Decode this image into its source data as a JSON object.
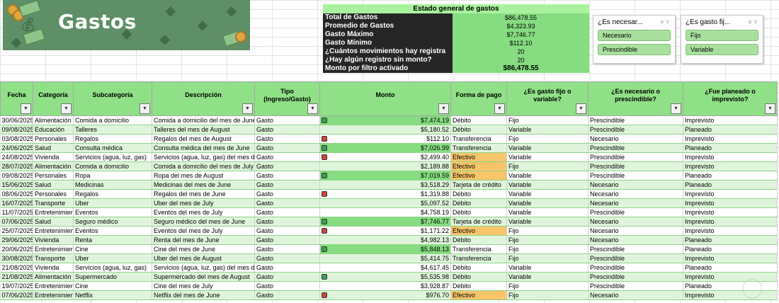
{
  "banner": {
    "title": "Gastos"
  },
  "summary": {
    "title": "Estado general de gastos",
    "rows": [
      {
        "label": "Total de Gastos",
        "value": "$86,478.55",
        "bold": false
      },
      {
        "label": "Promedio de Gastos",
        "value": "$4,323.93",
        "bold": false
      },
      {
        "label": "Gasto Máximo",
        "value": "$7,746.77",
        "bold": false
      },
      {
        "label": "Gasto Mínimo",
        "value": "$112.10",
        "bold": false
      },
      {
        "label": "¿Cuántos movimientos hay registra",
        "value": "20",
        "bold": false
      },
      {
        "label": "¿Hay algún registro sin monto?",
        "value": "20",
        "bold": false
      },
      {
        "label": "Monto por filtro activado",
        "value": "$86,478.55",
        "bold": true
      }
    ]
  },
  "slicers": [
    {
      "title": "¿Es necesar...",
      "items": [
        "Necesario",
        "Prescindible"
      ]
    },
    {
      "title": "¿Es gasto fij...",
      "items": [
        "Fijo",
        "Variable"
      ]
    }
  ],
  "table": {
    "headers": [
      "Fecha",
      "Categoría",
      "Subcategoría",
      "Descripción",
      "Tipo (Ingreso/Gasto)",
      "Monto",
      "Forma de pago",
      "¿Es gasto fijo o variable?",
      "¿Es necesario o prescindible?",
      "¿Fue planeado o imprevisto?"
    ],
    "rows": [
      [
        "30/06/2025",
        "Alimentación",
        "Comida a domicilio",
        "Comida a domicilio del mes de June",
        "Gasto",
        "$7,474.19",
        "Débito",
        "Fijo",
        "Prescindible",
        "Imprevisto"
      ],
      [
        "09/08/2025",
        "Educación",
        "Talleres",
        "Talleres del mes de August",
        "Gasto",
        "$5,180.52",
        "Débito",
        "Variable",
        "Prescindible",
        "Planeado"
      ],
      [
        "03/08/2025",
        "Personales",
        "Regalos",
        "Regalos del mes de August",
        "Gasto",
        "$112.10",
        "Transferencia",
        "Fijo",
        "Necesario",
        "Imprevisto"
      ],
      [
        "24/06/2025",
        "Salud",
        "Consulta médica",
        "Consulta médica del mes de June",
        "Gasto",
        "$7,026.99",
        "Transferencia",
        "Variable",
        "Prescindible",
        "Planeado"
      ],
      [
        "24/08/2025",
        "Vivienda",
        "Servicios (agua, luz, gas)",
        "Servicios (agua, luz, gas) del mes de August",
        "Gasto",
        "$2,499.40",
        "Efectivo",
        "Variable",
        "Prescindible",
        "Imprevisto"
      ],
      [
        "28/07/2025",
        "Alimentación",
        "Comida a domicilio",
        "Comida a domicilio del mes de July",
        "Gasto",
        "$2,189.88",
        "Efectivo",
        "Fijo",
        "Prescindible",
        "Imprevisto"
      ],
      [
        "09/08/2025",
        "Personales",
        "Ropa",
        "Ropa del mes de August",
        "Gasto",
        "$7,019.59",
        "Efectivo",
        "Variable",
        "Prescindible",
        "Planeado"
      ],
      [
        "15/06/2025",
        "Salud",
        "Medicinas",
        "Medicinas del mes de June",
        "Gasto",
        "$3,518.29",
        "Tarjeta de crédito",
        "Variable",
        "Necesario",
        "Planeado"
      ],
      [
        "08/06/2025",
        "Personales",
        "Regalos",
        "Regalos del mes de June",
        "Gasto",
        "$1,319.88",
        "Débito",
        "Variable",
        "Necesario",
        "Imprevisto"
      ],
      [
        "16/07/2025",
        "Transporte",
        "Uber",
        "Uber del mes de July",
        "Gasto",
        "$5,097.52",
        "Débito",
        "Variable",
        "Necesario",
        "Imprevisto"
      ],
      [
        "11/07/2025",
        "Entretenimiento",
        "Eventos",
        "Eventos del mes de July",
        "Gasto",
        "$4,758.19",
        "Débito",
        "Variable",
        "Prescindible",
        "Imprevisto"
      ],
      [
        "07/06/2025",
        "Salud",
        "Seguro médico",
        "Seguro médico del mes de June",
        "Gasto",
        "$7,746.77",
        "Tarjeta de crédito",
        "Variable",
        "Necesario",
        "Imprevisto"
      ],
      [
        "25/07/2025",
        "Entretenimiento",
        "Eventos",
        "Eventos del mes de July",
        "Gasto",
        "$1,171.22",
        "Efectivo",
        "Fijo",
        "Necesario",
        "Imprevisto"
      ],
      [
        "29/06/2025",
        "Vivienda",
        "Renta",
        "Renta del mes de June",
        "Gasto",
        "$4,982.13",
        "Débito",
        "Fijo",
        "Necesario",
        "Planeado"
      ],
      [
        "20/06/2025",
        "Entretenimiento",
        "Cine",
        "Cine del mes de June",
        "Gasto",
        "$5,848.13",
        "Transferencia",
        "Fijo",
        "Prescindible",
        "Planeado"
      ],
      [
        "30/08/2025",
        "Transporte",
        "Uber",
        "Uber del mes de August",
        "Gasto",
        "$5,414.75",
        "Transferencia",
        "Fijo",
        "Prescindible",
        "Imprevisto"
      ],
      [
        "21/08/2025",
        "Vivienda",
        "Servicios (agua, luz, gas)",
        "Servicios (agua, luz, gas) del mes de August",
        "Gasto",
        "$4,617.45",
        "Débito",
        "Variable",
        "Prescindible",
        "Planeado"
      ],
      [
        "21/08/2025",
        "Alimentación",
        "Supermercado",
        "Supermercado del mes de August",
        "Gasto",
        "$5,535.98",
        "Débito",
        "Variable",
        "Prescindible",
        "Imprevisto"
      ],
      [
        "19/07/2025",
        "Entretenimiento",
        "Cine",
        "Cine del mes de July",
        "Gasto",
        "$3,928.87",
        "Débito",
        "Fijo",
        "Prescindible",
        "Planeado"
      ],
      [
        "07/06/2025",
        "Entretenimiento",
        "Netflix",
        "Netflix del mes de June",
        "Gasto",
        "$976.70",
        "Efectivo",
        "Fijo",
        "Necesario",
        "Imprevisto"
      ]
    ],
    "monto_icons": [
      "green",
      "none",
      "red",
      "green",
      "red",
      "none",
      "green",
      "none",
      "red",
      "none",
      "none",
      "green",
      "red",
      "none",
      "green",
      "none",
      "none",
      "green",
      "none",
      "red"
    ],
    "monto_highlight": [
      true,
      false,
      false,
      true,
      false,
      false,
      true,
      false,
      false,
      false,
      false,
      true,
      false,
      false,
      true,
      false,
      false,
      false,
      false,
      false
    ],
    "pay_highlight": [
      false,
      false,
      false,
      false,
      true,
      true,
      true,
      false,
      false,
      false,
      false,
      false,
      true,
      false,
      false,
      false,
      false,
      false,
      false,
      true
    ]
  },
  "colors": {
    "banner": "#5f8f66",
    "header_green": "#8fe086",
    "summary_dark": "#262626",
    "highlight_green": "#86dc80",
    "highlight_orange": "#f8c56a",
    "icon_green": "#3f9e5a",
    "icon_red": "#c94a3a"
  },
  "icons": [
    "money-bag-icon",
    "coin-icon",
    "banknote-icon",
    "filter-dropdown-icon",
    "multi-select-icon",
    "clear-filter-icon",
    "status-square-icon"
  ]
}
